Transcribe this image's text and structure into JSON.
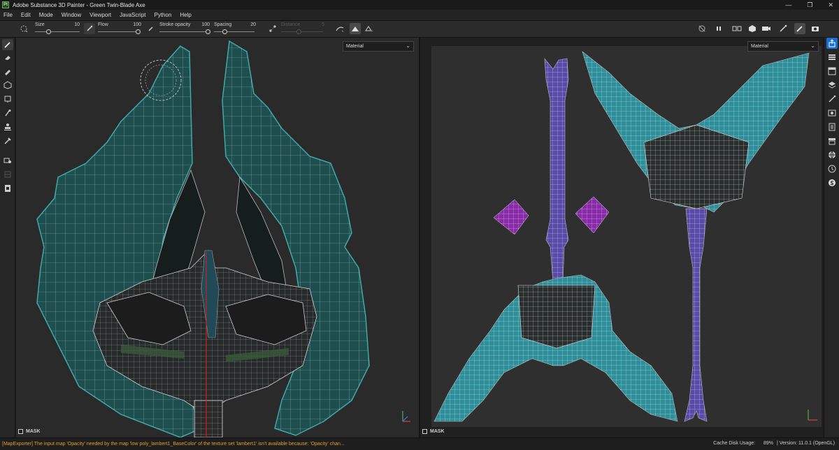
{
  "window": {
    "title": "Adobe Substance 3D Painter - Green Twin-Blade Axe",
    "logo_text": "Pt"
  },
  "menu": [
    "File",
    "Edit",
    "Mode",
    "Window",
    "Viewport",
    "JavaScript",
    "Python",
    "Help"
  ],
  "tool_options": {
    "size": {
      "label": "Size",
      "value": "10"
    },
    "flow": {
      "label": "Flow",
      "value": "100"
    },
    "stroke_opacity": {
      "label": "Stroke opacity",
      "value": "100"
    },
    "spacing": {
      "label": "Spacing",
      "value": "20"
    },
    "distance": {
      "label": "Distance",
      "value": "5",
      "enabled": false
    }
  },
  "viewports": {
    "view3d": {
      "mode": "Material",
      "mask_label": "MASK"
    },
    "view2d": {
      "mode": "Material",
      "mask_label": "MASK"
    }
  },
  "left_tools": [
    "paint-brush-icon",
    "eraser-icon",
    "projection-icon",
    "polygon-fill-icon",
    "smudge-icon",
    "clone-icon",
    "color-picker-icon",
    "stamp-icon",
    "geometry-mask-icon",
    "bake-icon",
    "export-icon"
  ],
  "right_tools": [
    "share-icon",
    "layers-icon",
    "texture-set-icon",
    "stack-icon",
    "brush-properties-icon",
    "display-settings-icon",
    "shader-settings-icon",
    "history-icon",
    "environment-icon",
    "log-icon",
    "substance-icon"
  ],
  "colors": {
    "accent_blue": "#1a6fd0",
    "warning_text": "#e0a030",
    "mesh_teal": "#1f6b6b",
    "uv_cyan": "#3ec9d6",
    "uv_purple": "#7a5fc8",
    "diamond_magenta": "#8a2aa8"
  },
  "status": {
    "message": "[MapExporter] The input map 'Opacity' needed by the map 'low poly_lambert1_BaseColor' of the texture set 'lambert1' isn't available because: 'Opacity' chan...",
    "cache_disk_label": "Cache Disk Usage:",
    "cache_disk_value": "89%",
    "version": "| Version: 11.0.1 (OpenGL)"
  }
}
